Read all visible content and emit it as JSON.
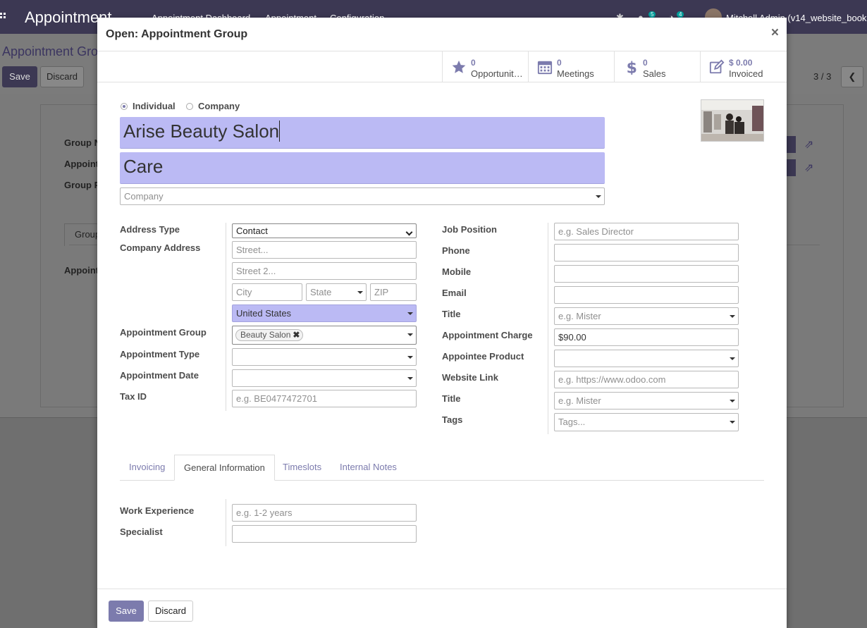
{
  "background": {
    "app_name": "Appointment",
    "menu": [
      "Appointment Dashboard",
      "Appointment",
      "Configuration"
    ],
    "chat_count": "5",
    "activity_count": "4",
    "user": "Mitchell Admin (v14_website_book",
    "breadcrumb": "Appointment Group",
    "save_label": "Save",
    "discard_label": "Discard",
    "pager": "3 / 3",
    "labels": [
      "Group N",
      "Appoint",
      "Group P"
    ],
    "tab_label": "Group",
    "lower_label": "Appoint"
  },
  "modal": {
    "title": "Open: Appointment Group",
    "close_symbol": "×"
  },
  "stat_buttons": [
    {
      "value": "0",
      "label": "Opportunit…"
    },
    {
      "value": "0",
      "label": "Meetings"
    },
    {
      "value": "0",
      "label": "Sales"
    },
    {
      "value": "$ 0.00",
      "label": "Invoiced"
    }
  ],
  "company_type": {
    "individual_label": "Individual",
    "company_label": "Company",
    "selected": "Individual"
  },
  "name": "Arise Beauty Salon",
  "subname": "Care",
  "company_placeholder": "Company",
  "left_fields": {
    "address_type_label": "Address Type",
    "address_type_value": "Contact",
    "company_address_label": "Company Address",
    "street_placeholder": "Street...",
    "street2_placeholder": "Street 2...",
    "city_placeholder": "City",
    "state_placeholder": "State",
    "zip_placeholder": "ZIP",
    "country_value": "United States",
    "appointment_group_label": "Appointment Group",
    "appointment_group_tag": "Beauty Salon",
    "appointment_type_label": "Appointment Type",
    "appointment_date_label": "Appointment Date",
    "tax_id_label": "Tax ID",
    "tax_id_placeholder": "e.g. BE0477472701"
  },
  "right_fields": {
    "job_position_label": "Job Position",
    "job_position_placeholder": "e.g. Sales Director",
    "phone_label": "Phone",
    "mobile_label": "Mobile",
    "email_label": "Email",
    "title_label": "Title",
    "title_placeholder": "e.g. Mister",
    "appointment_charge_label": "Appointment Charge",
    "appointment_charge_value": "$90.00",
    "appointee_product_label": "Appointee Product",
    "website_link_label": "Website Link",
    "website_link_placeholder": "e.g. https://www.odoo.com",
    "title2_label": "Title",
    "title2_placeholder": "e.g. Mister",
    "tags_label": "Tags",
    "tags_placeholder": "Tags..."
  },
  "tabs": [
    "Invoicing",
    "General Information",
    "Timeslots",
    "Internal Notes"
  ],
  "active_tab": "General Information",
  "general_info": {
    "work_experience_label": "Work Experience",
    "work_experience_placeholder": "e.g. 1-2 years",
    "specialist_label": "Specialist"
  },
  "footer": {
    "save_label": "Save",
    "discard_label": "Discard"
  },
  "colors": {
    "primary": "#7c7bad",
    "navbar": "#3c3853",
    "required_field": "#bbbaf4"
  }
}
